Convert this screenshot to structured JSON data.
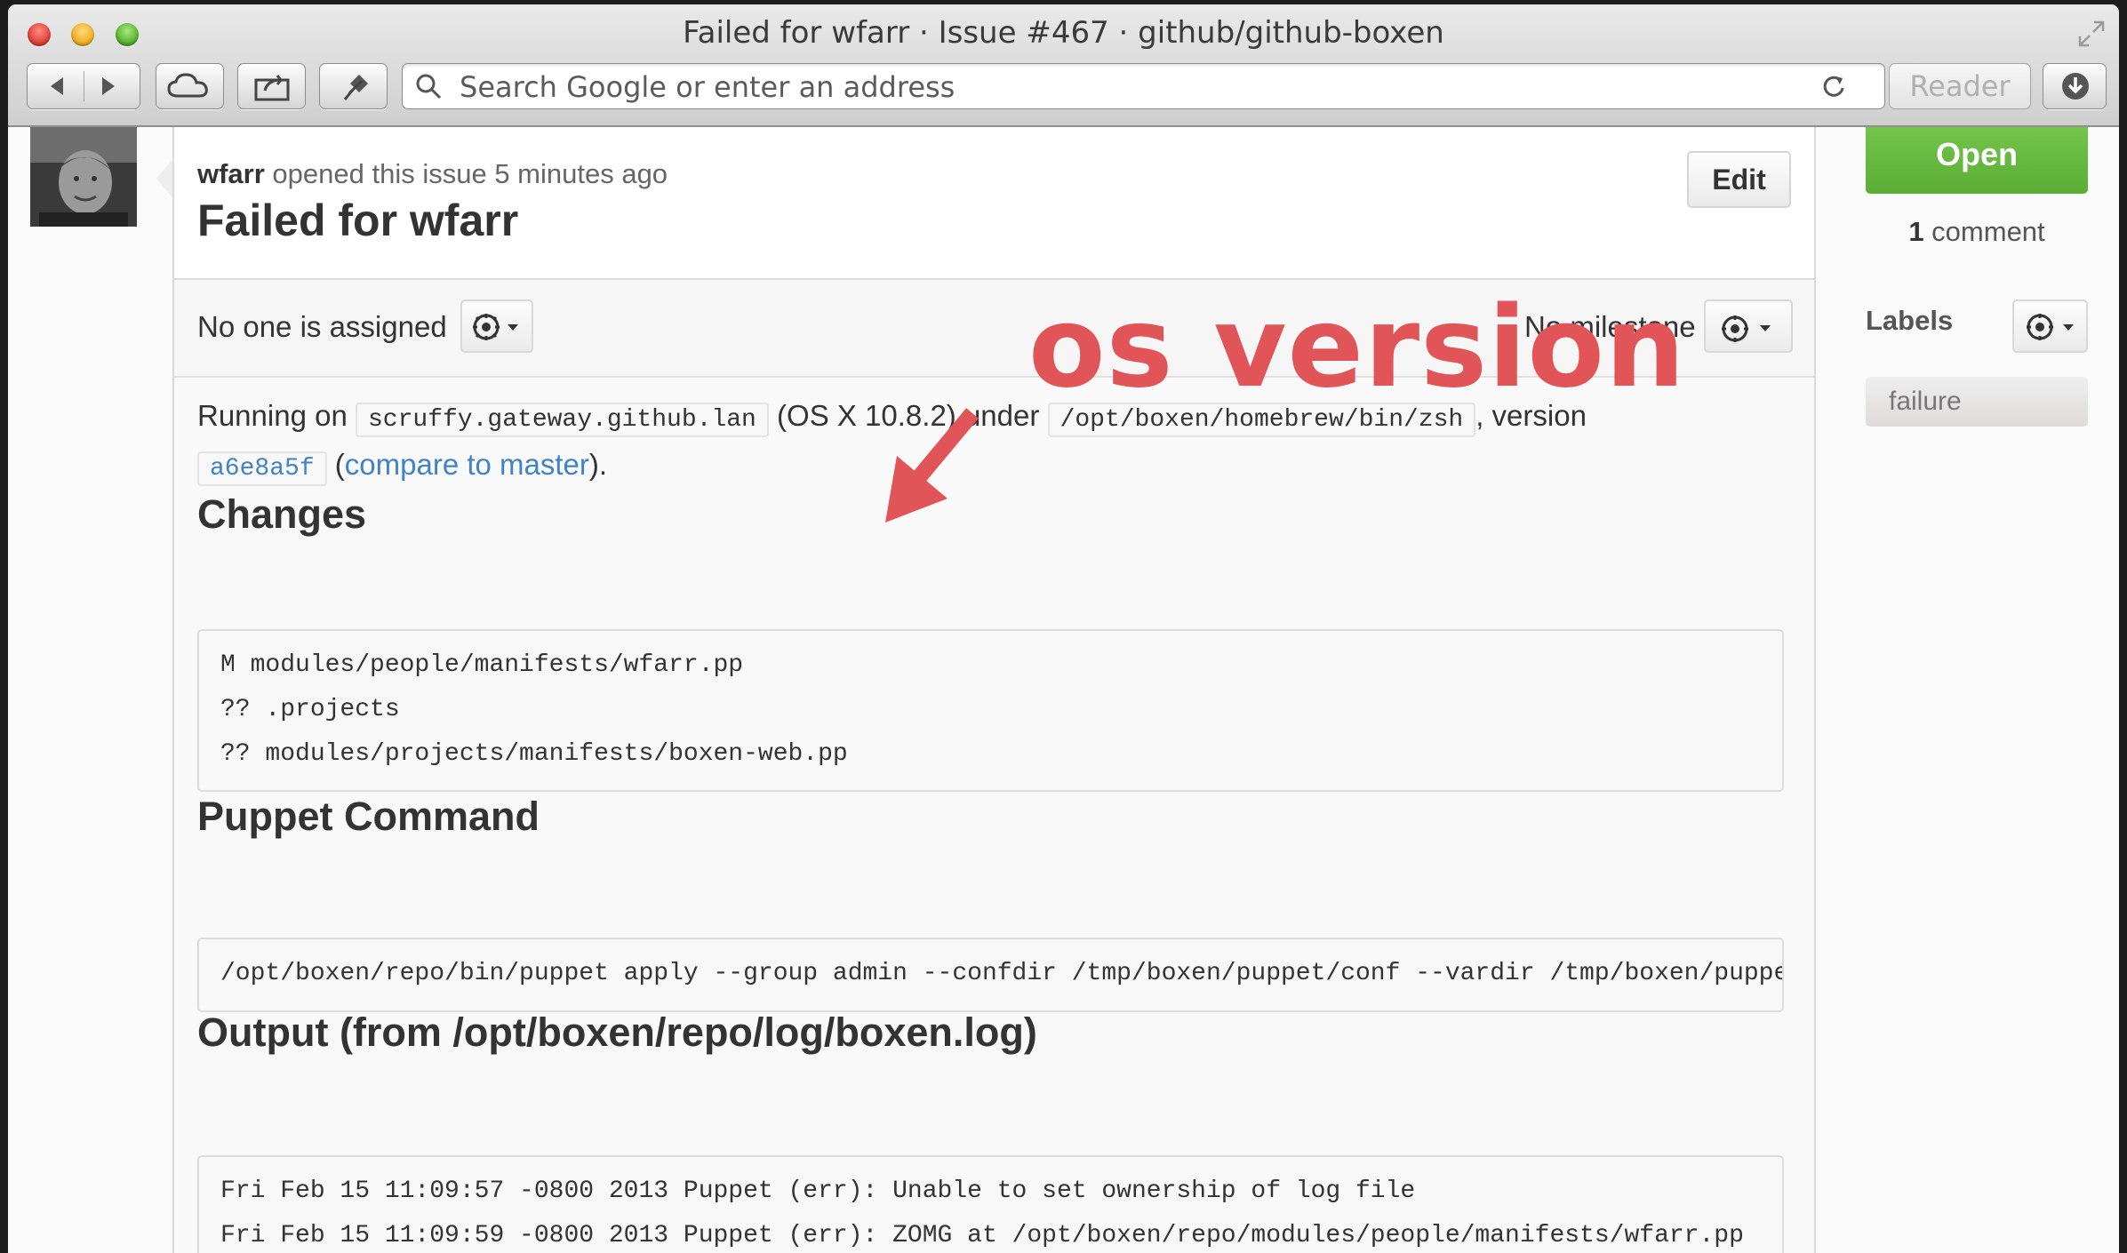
{
  "window": {
    "title": "Failed for wfarr · Issue #467 · github/github-boxen"
  },
  "toolbar": {
    "address_placeholder": "Search Google or enter an address",
    "reader_label": "Reader"
  },
  "issue": {
    "author": "wfarr",
    "opened_text": " opened this issue 5 minutes ago",
    "title": "Failed for wfarr",
    "edit_label": "Edit",
    "assignee_text": "No one is assigned",
    "milestone_text": "No milestone"
  },
  "body": {
    "running_on": "Running on",
    "host": "scruffy.gateway.github.lan",
    "os": "(OS X 10.8.2) under",
    "shell": "/opt/boxen/homebrew/bin/zsh",
    "version_label": ", version",
    "sha": "a6e8a5f",
    "compare_open": "(",
    "compare_link": "compare to master",
    "compare_close": ")."
  },
  "changes": {
    "heading": "Changes",
    "lines": [
      "M modules/people/manifests/wfarr.pp",
      "?? .projects",
      "?? modules/projects/manifests/boxen-web.pp"
    ]
  },
  "puppet": {
    "heading": "Puppet Command",
    "command": "/opt/boxen/repo/bin/puppet apply --group admin --confdir /tmp/boxen/puppet/conf --vardir /tmp/boxen/puppet"
  },
  "output": {
    "heading": "Output (from /opt/boxen/repo/log/boxen.log)",
    "lines": [
      "Fri Feb 15 11:09:57 -0800 2013 Puppet (err): Unable to set ownership of log file",
      "Fri Feb 15 11:09:59 -0800 2013 Puppet (err): ZOMG at /opt/boxen/repo/modules/people/manifests/wfarr.pp"
    ]
  },
  "sidebar": {
    "state": "Open",
    "comment_count": "1",
    "comment_label": " comment",
    "labels_heading": "Labels",
    "labels": [
      "failure"
    ]
  },
  "annotation": {
    "text": "os version",
    "color": "#e15457"
  },
  "colors": {
    "open_green": "#6cbf43",
    "link_blue": "#4183c4"
  }
}
